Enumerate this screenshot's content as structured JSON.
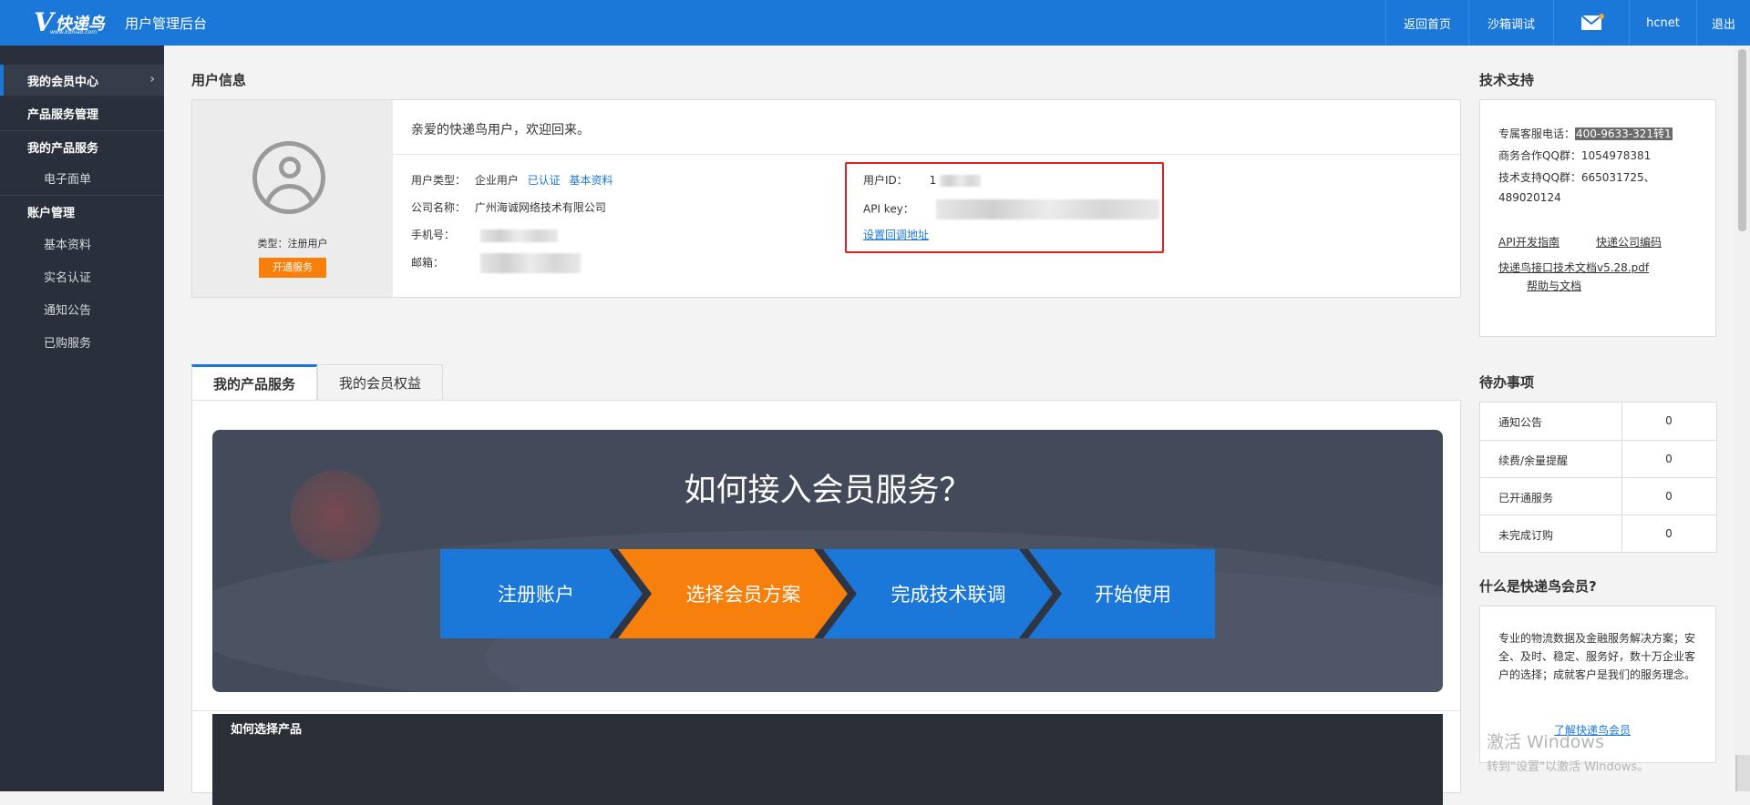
{
  "header": {
    "logo_mark": "V",
    "logo_text": "快递鸟",
    "logo_url": "www.kdniao.com",
    "app_title": "用户管理后台",
    "nav": {
      "home": "返回首页",
      "sandbox": "沙箱调试",
      "mail_icon": "mail-icon",
      "user": "hcnet",
      "logout": "退出"
    }
  },
  "sidebar": {
    "member_center": "我的会员中心",
    "product_mgmt": "产品服务管理",
    "my_products": "我的产品服务",
    "e_waybill": "电子面单",
    "account_mgmt": "账户管理",
    "basic_info": "基本资料",
    "real_name": "实名认证",
    "notices": "通知公告",
    "purchased": "已购服务"
  },
  "user_info": {
    "title": "用户信息",
    "account_type": "类型：注册用户",
    "open_service": "开通服务",
    "welcome": "亲爱的快递鸟用户，欢迎回来。",
    "user_type_label": "用户类型：",
    "user_type_value": "企业用户",
    "verified": "已认证",
    "basic_info_link": "基本资料",
    "company_label": "公司名称：",
    "company_value": "广州海诚网络技术有限公司",
    "phone_label": "手机号：",
    "email_label": "邮箱：",
    "user_id_label": "用户ID：",
    "user_id_value": "1",
    "api_key_label": "API key：",
    "callback_link": "设置回调地址"
  },
  "tabs": {
    "items": [
      "我的产品服务",
      "我的会员权益"
    ],
    "active": 0
  },
  "banner": {
    "title": "如何接入会员服务？",
    "steps": [
      "注册账户",
      "选择会员方案",
      "完成技术联调",
      "开始使用"
    ],
    "colors": {
      "blue": "#1b77d8",
      "orange": "#f77f0b"
    },
    "active_step": 1
  },
  "how_choose": "如何选择产品",
  "support": {
    "title": "技术支持",
    "phone_label": "专属客服电话：",
    "phone_value": "400-9633-321转1",
    "biz_qq": "商务合作QQ群：1054978381",
    "tech_qq": "技术支持QQ群：665031725、",
    "tech_qq2": "489020124",
    "api_guide": "API开发指南",
    "courier_codes": "快递公司编码",
    "doc_pdf": "快递鸟接口技术文档v5.28.pdf",
    "help_docs": "帮助与文档"
  },
  "todo": {
    "title": "待办事项",
    "rows": [
      {
        "label": "通知公告",
        "value": "0"
      },
      {
        "label": "续费/余量提醒",
        "value": "0"
      },
      {
        "label": "已开通服务",
        "value": "0"
      },
      {
        "label": "未完成订购",
        "value": "0"
      }
    ]
  },
  "member": {
    "title": "什么是快递鸟会员?",
    "desc": "专业的物流数据及金融服务解决方案；安全、及时、稳定、服务好，数十万企业客户的选择；成就客户是我们的服务理念。",
    "more": "了解快递鸟会员"
  },
  "watermark": {
    "line1": "激活 Windows",
    "line2": "转到\"设置\"以激活 Windows。"
  }
}
